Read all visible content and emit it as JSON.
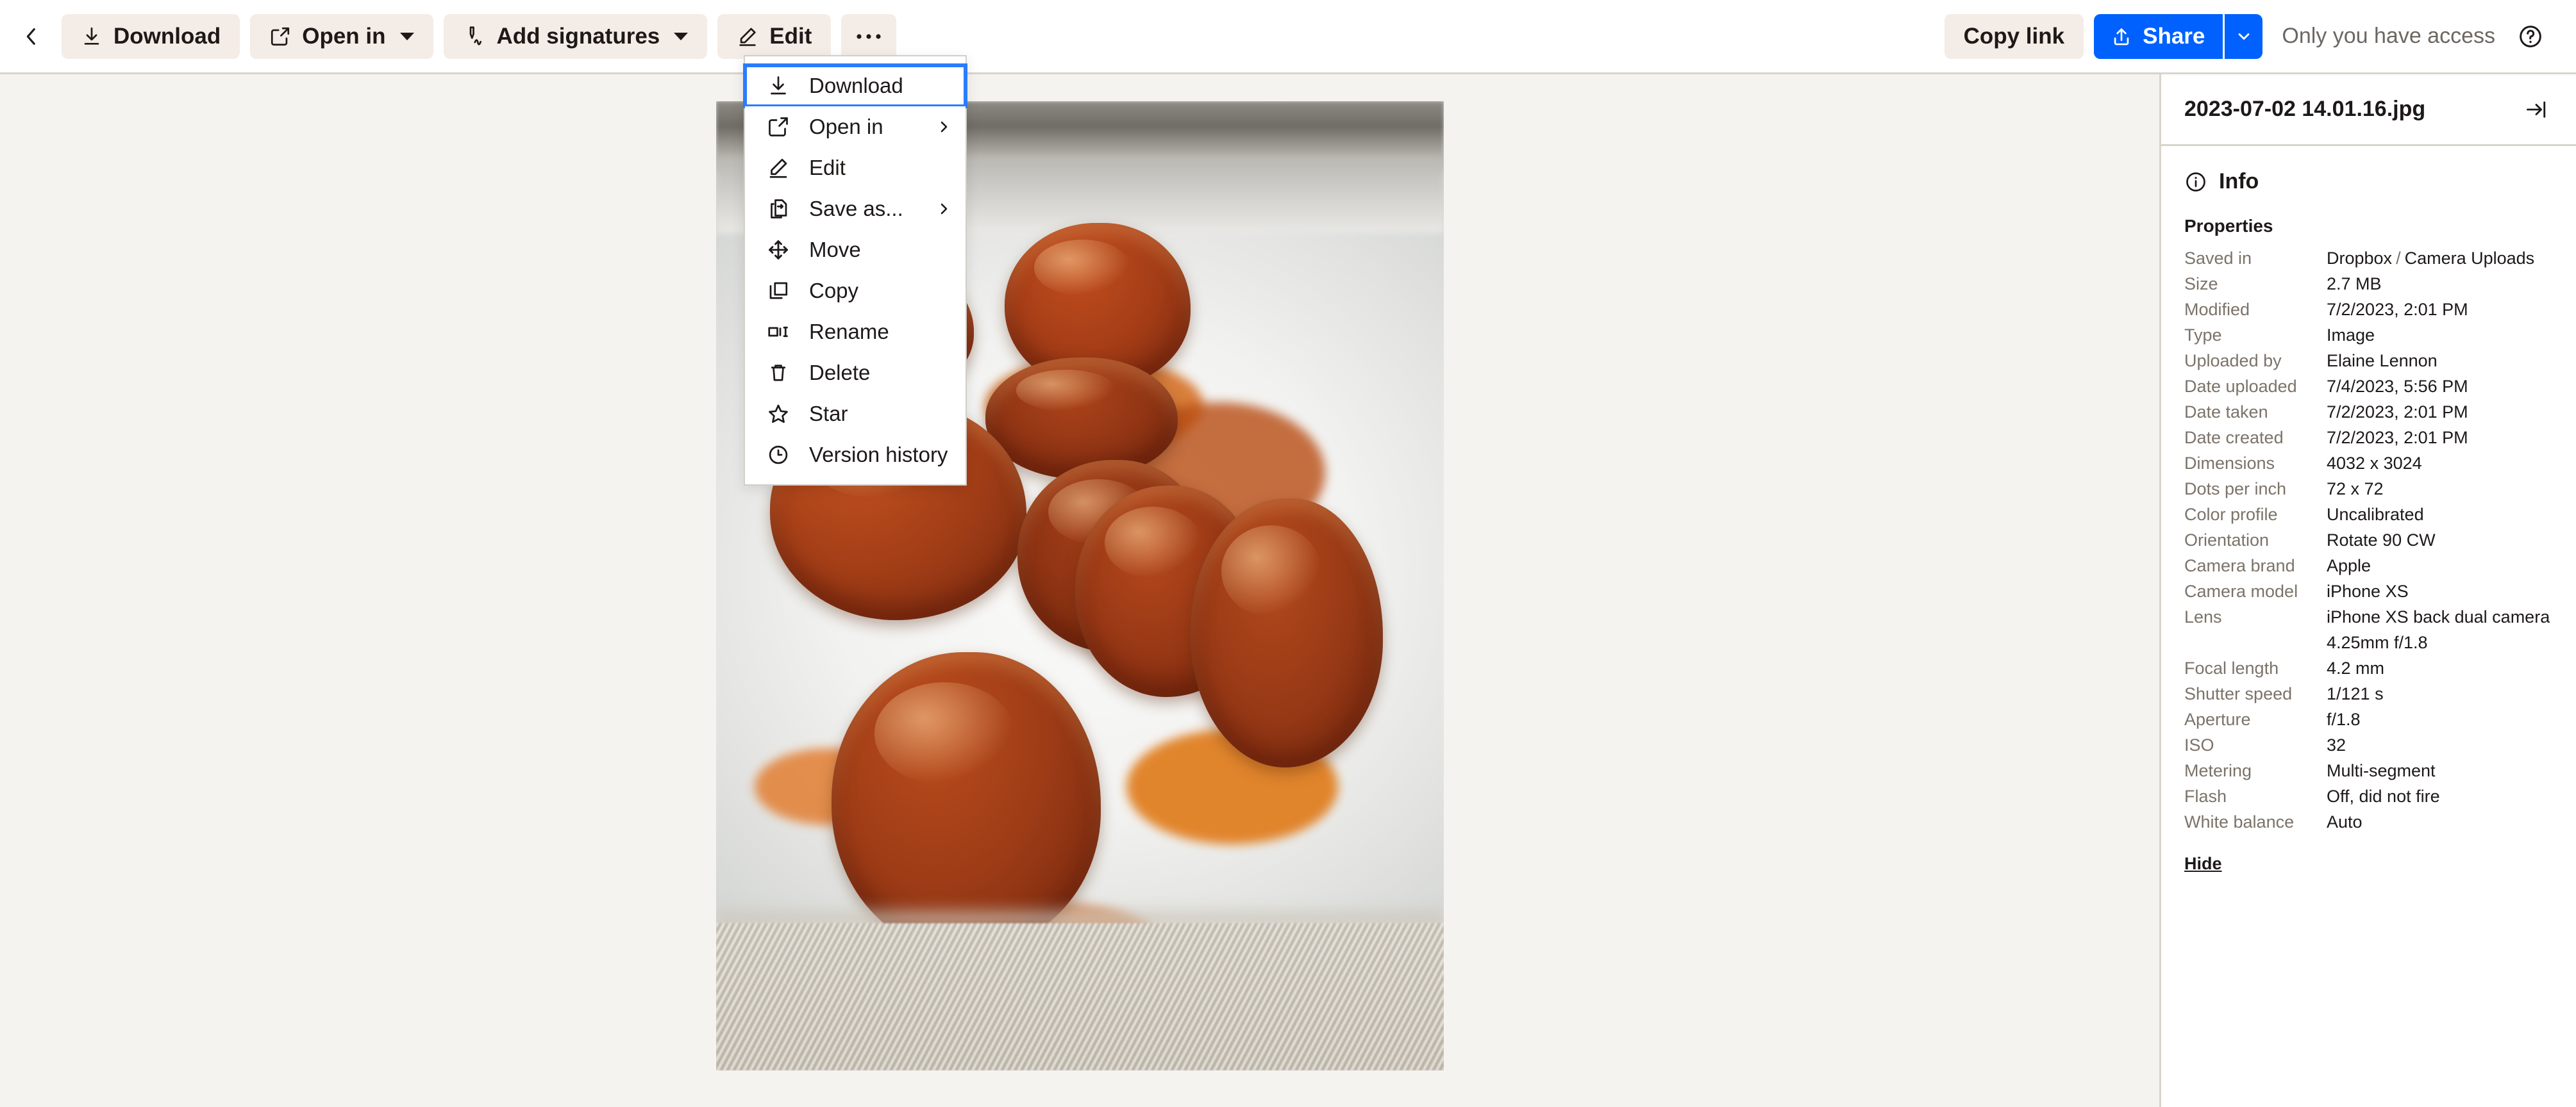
{
  "toolbar": {
    "back_label": "Back",
    "buttons": [
      {
        "id": "download",
        "label": "Download",
        "icon": "download-icon",
        "caret": false
      },
      {
        "id": "open-in",
        "label": "Open in",
        "icon": "external-link-icon",
        "caret": true
      },
      {
        "id": "add-signatures",
        "label": "Add signatures",
        "icon": "signature-pen-icon",
        "caret": true
      },
      {
        "id": "edit",
        "label": "Edit",
        "icon": "pencil-icon",
        "caret": false
      }
    ],
    "more_label": "•••",
    "copy_link_label": "Copy link",
    "share_label": "Share",
    "access_label": "Only you have access",
    "help_label": "?",
    "accent_color": "#0061fe",
    "button_bg_color": "#f4ece6"
  },
  "menu": {
    "focused_item": "Download",
    "items": [
      {
        "label": "Download",
        "icon": "download-icon",
        "submenu": false,
        "focused": true
      },
      {
        "label": "Open in",
        "icon": "external-link-icon",
        "submenu": true,
        "focused": false
      },
      {
        "label": "Edit",
        "icon": "pencil-icon",
        "submenu": false,
        "focused": false
      },
      {
        "label": "Save as...",
        "icon": "save-as-icon",
        "submenu": true,
        "focused": false
      },
      {
        "label": "Move",
        "icon": "move-arrows-icon",
        "submenu": false,
        "focused": false
      },
      {
        "label": "Copy",
        "icon": "copy-icon",
        "submenu": false,
        "focused": false
      },
      {
        "label": "Rename",
        "icon": "rename-icon",
        "submenu": false,
        "focused": false
      },
      {
        "label": "Delete",
        "icon": "trash-icon",
        "submenu": false,
        "focused": false
      },
      {
        "label": "Star",
        "icon": "star-icon",
        "submenu": false,
        "focused": false
      },
      {
        "label": "Version history",
        "icon": "clock-icon",
        "submenu": false,
        "focused": false
      }
    ]
  },
  "preview": {
    "alt": "Photograph of sliced chorizo sausage in orange sauce on a white plate",
    "background_color": "#f5f3ef"
  },
  "sidebar": {
    "file_name": "2023-07-02 14.01.16.jpg",
    "collapse_label": "Collapse panel",
    "info_label": "Info",
    "properties_heading": "Properties",
    "hide_label": "Hide",
    "properties": [
      {
        "key": "Saved in",
        "value": "Dropbox",
        "value2": "Camera Uploads",
        "sep": "/"
      },
      {
        "key": "Size",
        "value": "2.7 MB"
      },
      {
        "key": "Modified",
        "value": "7/2/2023, 2:01 PM"
      },
      {
        "key": "Type",
        "value": "Image"
      },
      {
        "key": "Uploaded by",
        "value": "Elaine Lennon"
      },
      {
        "key": "Date uploaded",
        "value": "7/4/2023, 5:56 PM"
      },
      {
        "key": "Date taken",
        "value": "7/2/2023, 2:01 PM"
      },
      {
        "key": "Date created",
        "value": "7/2/2023, 2:01 PM"
      },
      {
        "key": "Dimensions",
        "value": "4032 x 3024"
      },
      {
        "key": "Dots per inch",
        "value": "72 x 72"
      },
      {
        "key": "Color profile",
        "value": "Uncalibrated"
      },
      {
        "key": "Orientation",
        "value": "Rotate 90 CW"
      },
      {
        "key": "Camera brand",
        "value": "Apple"
      },
      {
        "key": "Camera model",
        "value": "iPhone XS"
      },
      {
        "key": "Lens",
        "value": "iPhone XS back dual camera 4.25mm f/1.8"
      },
      {
        "key": "Focal length",
        "value": "4.2 mm"
      },
      {
        "key": "Shutter speed",
        "value": "1/121 s"
      },
      {
        "key": "Aperture",
        "value": "f/1.8"
      },
      {
        "key": "ISO",
        "value": "32"
      },
      {
        "key": "Metering",
        "value": "Multi-segment"
      },
      {
        "key": "Flash",
        "value": "Off, did not fire"
      },
      {
        "key": "White balance",
        "value": "Auto"
      }
    ]
  }
}
